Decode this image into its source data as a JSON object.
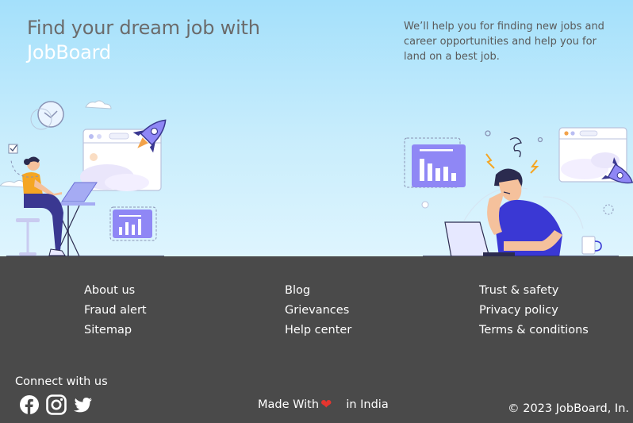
{
  "hero": {
    "title_line1": "Find your dream job with",
    "title_brand": "JobBoard",
    "subtitle": "We’ll help you for finding new jobs and career opportunities and help you for land on a best job."
  },
  "footer": {
    "columns": [
      {
        "links": [
          "About us",
          "Fraud alert",
          "Sitemap"
        ]
      },
      {
        "links": [
          "Blog",
          "Grievances",
          "Help center"
        ]
      },
      {
        "links": [
          "Trust & safety",
          "Privacy policy",
          "Terms & conditions"
        ]
      }
    ],
    "connect_label": "Connect with us",
    "socials": [
      "facebook-icon",
      "instagram-icon",
      "twitter-icon"
    ],
    "made_with_prefix": "Made With",
    "heart_glyph": "❤",
    "made_with_suffix": "in India",
    "copyright": "© 2023 JobBoard, In."
  },
  "colors": {
    "hero_top": "#a4e0fb",
    "hero_bottom": "#def5fe",
    "footer_bg": "#4a4a4a",
    "accent_purple": "#8f87f5",
    "heart": "#e5352f"
  }
}
